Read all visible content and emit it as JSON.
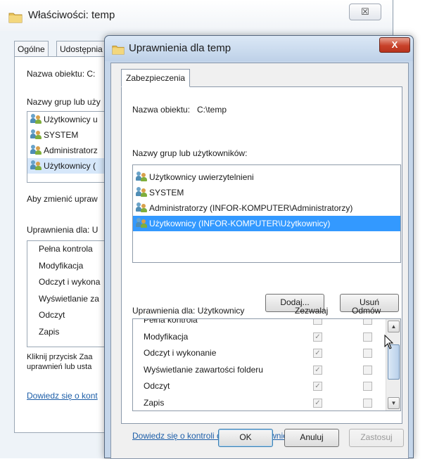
{
  "background_window": {
    "title": "Właściwości: temp",
    "close": "☒",
    "tabs": [
      "Ogólne",
      "Udostępnia"
    ],
    "object_name_label": "Nazwa obiektu: C:",
    "groups_label": "Nazwy grup lub uży",
    "groups": [
      "Użytkownicy u",
      "SYSTEM",
      "Administratorz",
      "Użytkownicy ("
    ],
    "change_perm_text": "Aby zmienić upraw",
    "perms_for_label": "Uprawnienia dla: U",
    "permissions": [
      "Pełna kontrola",
      "Modyfikacja",
      "Odczyt i wykona",
      "Wyświetlanie za",
      "Odczyt",
      "Zapis"
    ],
    "click_text_1": "Kliknij przycisk Zaa",
    "click_text_2": "uprawnień lub usta",
    "learn_link": "Dowiedz się o kont"
  },
  "dialog": {
    "title": "Uprawnienia dla temp",
    "close": "X",
    "tab": "Zabezpieczenia",
    "object_name_label": "Nazwa obiektu:",
    "object_name_value": "C:\\temp",
    "groups_label": "Nazwy grup lub użytkowników:",
    "groups": [
      "Użytkownicy uwierzytelnieni",
      "SYSTEM",
      "Administratorzy (INFOR-KOMPUTER\\Administratorzy)",
      "Użytkownicy (INFOR-KOMPUTER\\Użytkownicy)"
    ],
    "add_button": "Dodaj...",
    "remove_button": "Usuń",
    "perms_for_label": "Uprawnienia dla: Użytkownicy",
    "allow_header": "Zezwalaj",
    "deny_header": "Odmów",
    "permissions": [
      {
        "name": "Pełna kontrola",
        "allow": false,
        "deny": false
      },
      {
        "name": "Modyfikacja",
        "allow": true,
        "deny": false
      },
      {
        "name": "Odczyt i wykonanie",
        "allow": true,
        "deny": false
      },
      {
        "name": "Wyświetlanie zawartości folderu",
        "allow": true,
        "deny": false
      },
      {
        "name": "Odczyt",
        "allow": true,
        "deny": false
      },
      {
        "name": "Zapis",
        "allow": true,
        "deny": false
      }
    ],
    "learn_link": "Dowiedz się o kontroli dostępu i uprawnieniach",
    "ok_button": "OK",
    "cancel_button": "Anuluj",
    "apply_button": "Zastosuj"
  }
}
